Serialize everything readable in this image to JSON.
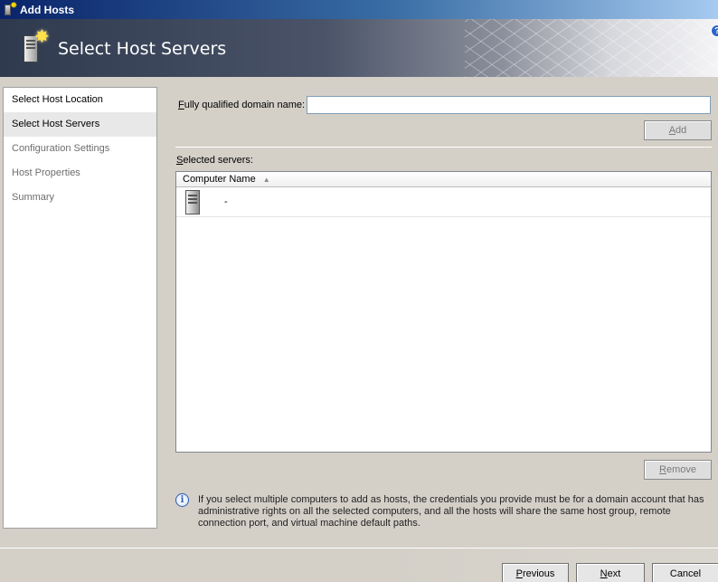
{
  "window": {
    "title": "Add Hosts",
    "icon": "host-server-star-icon"
  },
  "banner": {
    "title": "Select Host Servers",
    "icon": "host-server-star-icon",
    "help": "?"
  },
  "nav": {
    "items": [
      {
        "label": "Select Host Location",
        "state": "done"
      },
      {
        "label": "Select Host Servers",
        "state": "selected"
      },
      {
        "label": "Configuration Settings",
        "state": "pending"
      },
      {
        "label": "Host Properties",
        "state": "pending"
      },
      {
        "label": "Summary",
        "state": "pending"
      }
    ]
  },
  "fqdn": {
    "label_prefix": "F",
    "label_rest": "ully qualified domain name:",
    "value": ""
  },
  "add_button": {
    "accel": "A",
    "rest": "dd",
    "enabled": false
  },
  "selected_servers": {
    "label_prefix": "S",
    "label_rest": "elected servers:",
    "columns": [
      {
        "label": "Computer Name",
        "sort": "ascending"
      }
    ],
    "rows": [
      {
        "computer_name": "-",
        "icon": "server-icon"
      }
    ]
  },
  "remove_button": {
    "accel": "R",
    "rest": "emove",
    "enabled": false
  },
  "info": {
    "icon": "info-icon",
    "text": "If you select multiple computers to add as hosts, the credentials you provide must be for a domain account that has administrative rights on all the selected computers, and all the hosts will share the same host group, remote connection port, and virtual machine default paths."
  },
  "footer": {
    "previous": {
      "accel": "P",
      "rest": "revious"
    },
    "next": {
      "accel": "N",
      "rest": "ext"
    },
    "cancel": "Cancel"
  }
}
